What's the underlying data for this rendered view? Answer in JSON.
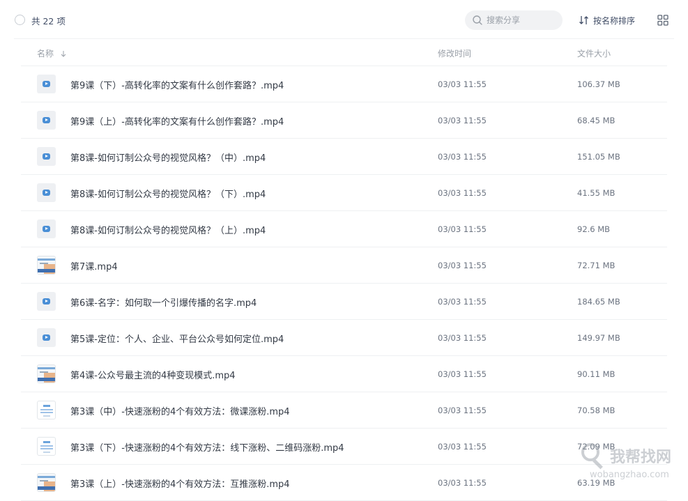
{
  "toolbar": {
    "count_label": "共 22 项",
    "search_placeholder": "搜索分享",
    "sort_label": "按名称排序"
  },
  "columns": {
    "name": "名称",
    "modified": "修改时间",
    "size": "文件大小"
  },
  "files": [
    {
      "name": "第9课（下）-高转化率的文案有什么创作套路？.mp4",
      "modified": "03/03 11:55",
      "size": "106.37 MB",
      "thumb": "video"
    },
    {
      "name": "第9课（上）-高转化率的文案有什么创作套路？.mp4",
      "modified": "03/03 11:55",
      "size": "68.45 MB",
      "thumb": "video"
    },
    {
      "name": "第8课-如何订制公众号的视觉风格？（中）.mp4",
      "modified": "03/03 11:55",
      "size": "151.05 MB",
      "thumb": "video"
    },
    {
      "name": "第8课-如何订制公众号的视觉风格？（下）.mp4",
      "modified": "03/03 11:55",
      "size": "41.55 MB",
      "thumb": "video"
    },
    {
      "name": "第8课-如何订制公众号的视觉风格？（上）.mp4",
      "modified": "03/03 11:55",
      "size": "92.6 MB",
      "thumb": "video"
    },
    {
      "name": "第7课.mp4",
      "modified": "03/03 11:55",
      "size": "72.71 MB",
      "thumb": "photo"
    },
    {
      "name": "第6课-名字：如何取一个引爆传播的名字.mp4",
      "modified": "03/03 11:55",
      "size": "184.65 MB",
      "thumb": "video"
    },
    {
      "name": "第5课-定位：个人、企业、平台公众号如何定位.mp4",
      "modified": "03/03 11:55",
      "size": "149.97 MB",
      "thumb": "video"
    },
    {
      "name": "第4课-公众号最主流的4种变现模式.mp4",
      "modified": "03/03 11:55",
      "size": "90.11 MB",
      "thumb": "photo"
    },
    {
      "name": "第3课（中）-快速涨粉的4个有效方法：微课涨粉.mp4",
      "modified": "03/03 11:55",
      "size": "70.58 MB",
      "thumb": "doc"
    },
    {
      "name": "第3课（下）-快速涨粉的4个有效方法：线下涨粉、二维码涨粉.mp4",
      "modified": "03/03 11:55",
      "size": "72.09 MB",
      "thumb": "doc"
    },
    {
      "name": "第3课（上）-快速涨粉的4个有效方法：互推涨粉.mp4",
      "modified": "03/03 11:55",
      "size": "63.19 MB",
      "thumb": "photo"
    }
  ],
  "watermark": {
    "cn": "我帮找网",
    "en": "wobangzhao.com"
  },
  "colors": {
    "video_icon": "#4a8fd6",
    "text_primary": "#333a45",
    "text_muted": "#9aa0a8"
  }
}
